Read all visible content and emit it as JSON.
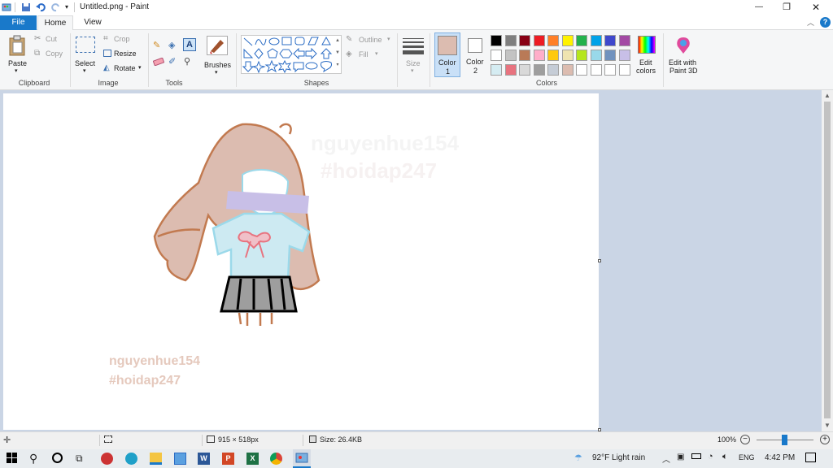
{
  "titlebar": {
    "title": "Untitled.png - Paint",
    "controls": {
      "minimize": "—",
      "maximize": "❐",
      "close": "✕"
    }
  },
  "tabs": {
    "file": "File",
    "home": "Home",
    "view": "View"
  },
  "ribbon": {
    "clipboard": {
      "paste": "Paste",
      "cut": "Cut",
      "copy": "Copy",
      "label": "Clipboard"
    },
    "image": {
      "select": "Select",
      "crop": "Crop",
      "resize": "Resize",
      "rotate": "Rotate",
      "label": "Image"
    },
    "tools": {
      "label": "Tools"
    },
    "brushes": {
      "label": "Brushes"
    },
    "shapes": {
      "outline": "Outline",
      "fill": "Fill",
      "label": "Shapes"
    },
    "size": {
      "label": "Size"
    },
    "colors": {
      "color1": "Color",
      "color1_num": "1",
      "color2": "Color",
      "color2_num": "2",
      "edit": "Edit",
      "edit2": "colors",
      "label": "Colors",
      "color1_value": "#dcbcb0",
      "color2_value": "#ffffff",
      "palette_row1": [
        "#000000",
        "#7f7f7f",
        "#880015",
        "#ed1c24",
        "#ff7f27",
        "#fff200",
        "#22b14c",
        "#00a2e8",
        "#3f48cc",
        "#a349a4"
      ],
      "palette_row2": [
        "#ffffff",
        "#c3c3c3",
        "#b97a57",
        "#ffaec9",
        "#ffc90e",
        "#efe4b0",
        "#b5e61d",
        "#99d9ea",
        "#7092be",
        "#c8bfe7"
      ],
      "palette_row3": [
        "#d5ecf2",
        "#e8737f",
        "#d9d9d9",
        "#9e9e9e",
        "#c5ccd6",
        "#dcbcb0",
        "#ffffff",
        "#ffffff",
        "#ffffff",
        "#ffffff"
      ]
    },
    "paint3d": {
      "line1": "Edit with",
      "line2": "Paint 3D"
    }
  },
  "canvas": {
    "watermark1": "nguyenhue154",
    "watermark2": "#hoidap247",
    "faint1": "nguyenhue154",
    "faint2": "#hoidap247",
    "mask_text": "???"
  },
  "statusbar": {
    "dimensions": "915 × 518px",
    "size": "Size: 26.4KB",
    "zoom": "100%"
  },
  "taskbar": {
    "weather": "92°F  Light rain",
    "lang": "ENG",
    "time": "4:42 PM"
  }
}
